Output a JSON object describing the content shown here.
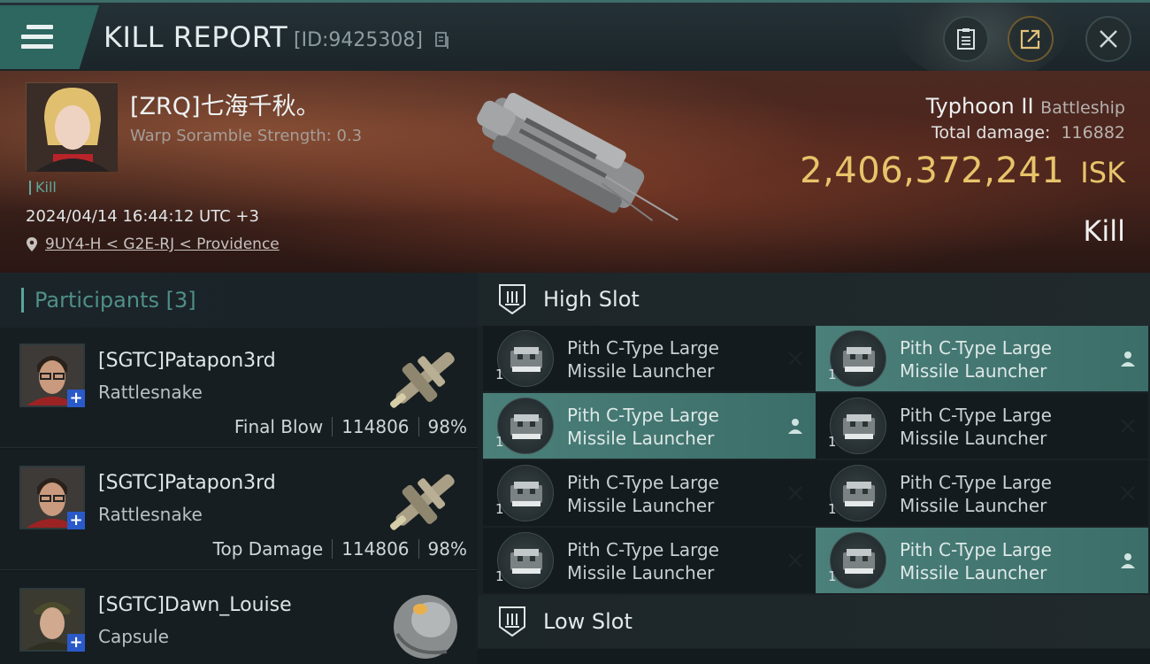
{
  "header": {
    "title": "KILL REPORT",
    "report_id": "[ID:9425308]",
    "buttons": [
      "clipboard-icon",
      "export-icon",
      "close-icon"
    ]
  },
  "victim": {
    "name": "[ZRQ]七海千秋。",
    "warp_scramble": "Warp Soramble Strength: 0.3",
    "tag": "Kill",
    "timestamp": "2024/04/14 16:44:12 UTC +3",
    "location": "9UY4-H < G2E-RJ < Providence",
    "ship_name": "Typhoon II",
    "ship_class": "Battleship",
    "total_damage_label": "Total damage:",
    "total_damage": "116882",
    "isk_value": "2,406,372,241",
    "isk_unit": "ISK",
    "result": "Kill"
  },
  "participants": {
    "label": "Participants [3]",
    "rows": [
      {
        "name": "[SGTC]Patapon3rd",
        "ship": "Rattlesnake",
        "role": "Final Blow",
        "damage": "114806",
        "percent": "98%"
      },
      {
        "name": "[SGTC]Patapon3rd",
        "ship": "Rattlesnake",
        "role": "Top Damage",
        "damage": "114806",
        "percent": "98%"
      },
      {
        "name": "[SGTC]Dawn_Louise",
        "ship": "Capsule"
      }
    ]
  },
  "high_slot": {
    "label": "High Slot",
    "modules": [
      {
        "name": "Pith C-Type Large Missile Launcher",
        "qty": "1",
        "status": "destroyed"
      },
      {
        "name": "Pith C-Type Large Missile Launcher",
        "qty": "1",
        "status": "dropped"
      },
      {
        "name": "Pith C-Type Large Missile Launcher",
        "qty": "1",
        "status": "dropped"
      },
      {
        "name": "Pith C-Type Large Missile Launcher",
        "qty": "1",
        "status": "destroyed"
      },
      {
        "name": "Pith C-Type Large Missile Launcher",
        "qty": "1",
        "status": "destroyed"
      },
      {
        "name": "Pith C-Type Large Missile Launcher",
        "qty": "1",
        "status": "destroyed"
      },
      {
        "name": "Pith C-Type Large Missile Launcher",
        "qty": "1",
        "status": "destroyed"
      },
      {
        "name": "Pith C-Type Large Missile Launcher",
        "qty": "1",
        "status": "dropped"
      }
    ]
  },
  "low_slot": {
    "label": "Low Slot"
  },
  "colors": {
    "accent": "#58a69c",
    "isk": "#e7c46a",
    "selected_row": "#4b7f79"
  }
}
